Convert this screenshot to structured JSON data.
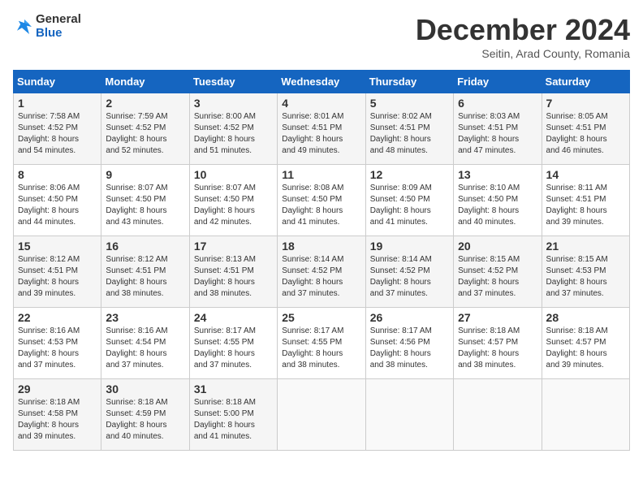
{
  "logo": {
    "general": "General",
    "blue": "Blue"
  },
  "title": "December 2024",
  "subtitle": "Seitin, Arad County, Romania",
  "days_header": [
    "Sunday",
    "Monday",
    "Tuesday",
    "Wednesday",
    "Thursday",
    "Friday",
    "Saturday"
  ],
  "weeks": [
    [
      {
        "day": "1",
        "sunrise": "7:58 AM",
        "sunset": "4:52 PM",
        "daylight": "8 hours and 54 minutes."
      },
      {
        "day": "2",
        "sunrise": "7:59 AM",
        "sunset": "4:52 PM",
        "daylight": "8 hours and 52 minutes."
      },
      {
        "day": "3",
        "sunrise": "8:00 AM",
        "sunset": "4:52 PM",
        "daylight": "8 hours and 51 minutes."
      },
      {
        "day": "4",
        "sunrise": "8:01 AM",
        "sunset": "4:51 PM",
        "daylight": "8 hours and 49 minutes."
      },
      {
        "day": "5",
        "sunrise": "8:02 AM",
        "sunset": "4:51 PM",
        "daylight": "8 hours and 48 minutes."
      },
      {
        "day": "6",
        "sunrise": "8:03 AM",
        "sunset": "4:51 PM",
        "daylight": "8 hours and 47 minutes."
      },
      {
        "day": "7",
        "sunrise": "8:05 AM",
        "sunset": "4:51 PM",
        "daylight": "8 hours and 46 minutes."
      }
    ],
    [
      {
        "day": "8",
        "sunrise": "8:06 AM",
        "sunset": "4:50 PM",
        "daylight": "8 hours and 44 minutes."
      },
      {
        "day": "9",
        "sunrise": "8:07 AM",
        "sunset": "4:50 PM",
        "daylight": "8 hours and 43 minutes."
      },
      {
        "day": "10",
        "sunrise": "8:07 AM",
        "sunset": "4:50 PM",
        "daylight": "8 hours and 42 minutes."
      },
      {
        "day": "11",
        "sunrise": "8:08 AM",
        "sunset": "4:50 PM",
        "daylight": "8 hours and 41 minutes."
      },
      {
        "day": "12",
        "sunrise": "8:09 AM",
        "sunset": "4:50 PM",
        "daylight": "8 hours and 41 minutes."
      },
      {
        "day": "13",
        "sunrise": "8:10 AM",
        "sunset": "4:50 PM",
        "daylight": "8 hours and 40 minutes."
      },
      {
        "day": "14",
        "sunrise": "8:11 AM",
        "sunset": "4:51 PM",
        "daylight": "8 hours and 39 minutes."
      }
    ],
    [
      {
        "day": "15",
        "sunrise": "8:12 AM",
        "sunset": "4:51 PM",
        "daylight": "8 hours and 39 minutes."
      },
      {
        "day": "16",
        "sunrise": "8:12 AM",
        "sunset": "4:51 PM",
        "daylight": "8 hours and 38 minutes."
      },
      {
        "day": "17",
        "sunrise": "8:13 AM",
        "sunset": "4:51 PM",
        "daylight": "8 hours and 38 minutes."
      },
      {
        "day": "18",
        "sunrise": "8:14 AM",
        "sunset": "4:52 PM",
        "daylight": "8 hours and 37 minutes."
      },
      {
        "day": "19",
        "sunrise": "8:14 AM",
        "sunset": "4:52 PM",
        "daylight": "8 hours and 37 minutes."
      },
      {
        "day": "20",
        "sunrise": "8:15 AM",
        "sunset": "4:52 PM",
        "daylight": "8 hours and 37 minutes."
      },
      {
        "day": "21",
        "sunrise": "8:15 AM",
        "sunset": "4:53 PM",
        "daylight": "8 hours and 37 minutes."
      }
    ],
    [
      {
        "day": "22",
        "sunrise": "8:16 AM",
        "sunset": "4:53 PM",
        "daylight": "8 hours and 37 minutes."
      },
      {
        "day": "23",
        "sunrise": "8:16 AM",
        "sunset": "4:54 PM",
        "daylight": "8 hours and 37 minutes."
      },
      {
        "day": "24",
        "sunrise": "8:17 AM",
        "sunset": "4:55 PM",
        "daylight": "8 hours and 37 minutes."
      },
      {
        "day": "25",
        "sunrise": "8:17 AM",
        "sunset": "4:55 PM",
        "daylight": "8 hours and 38 minutes."
      },
      {
        "day": "26",
        "sunrise": "8:17 AM",
        "sunset": "4:56 PM",
        "daylight": "8 hours and 38 minutes."
      },
      {
        "day": "27",
        "sunrise": "8:18 AM",
        "sunset": "4:57 PM",
        "daylight": "8 hours and 38 minutes."
      },
      {
        "day": "28",
        "sunrise": "8:18 AM",
        "sunset": "4:57 PM",
        "daylight": "8 hours and 39 minutes."
      }
    ],
    [
      {
        "day": "29",
        "sunrise": "8:18 AM",
        "sunset": "4:58 PM",
        "daylight": "8 hours and 39 minutes."
      },
      {
        "day": "30",
        "sunrise": "8:18 AM",
        "sunset": "4:59 PM",
        "daylight": "8 hours and 40 minutes."
      },
      {
        "day": "31",
        "sunrise": "8:18 AM",
        "sunset": "5:00 PM",
        "daylight": "8 hours and 41 minutes."
      },
      null,
      null,
      null,
      null
    ]
  ]
}
